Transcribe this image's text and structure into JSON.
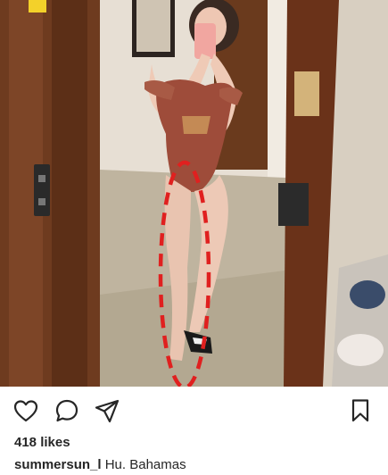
{
  "post": {
    "likes_text": "418 likes",
    "username": "summersun_l",
    "caption_text": "Hu. Bahamas"
  },
  "actions": [
    {
      "name": "like",
      "icon": "heart-icon"
    },
    {
      "name": "comment",
      "icon": "comment-bubble-icon"
    },
    {
      "name": "share",
      "icon": "paper-plane-icon"
    },
    {
      "name": "save",
      "icon": "bookmark-icon"
    }
  ],
  "colors": {
    "text": "#262626",
    "annotation": "#e0201f",
    "background": "#ffffff"
  }
}
